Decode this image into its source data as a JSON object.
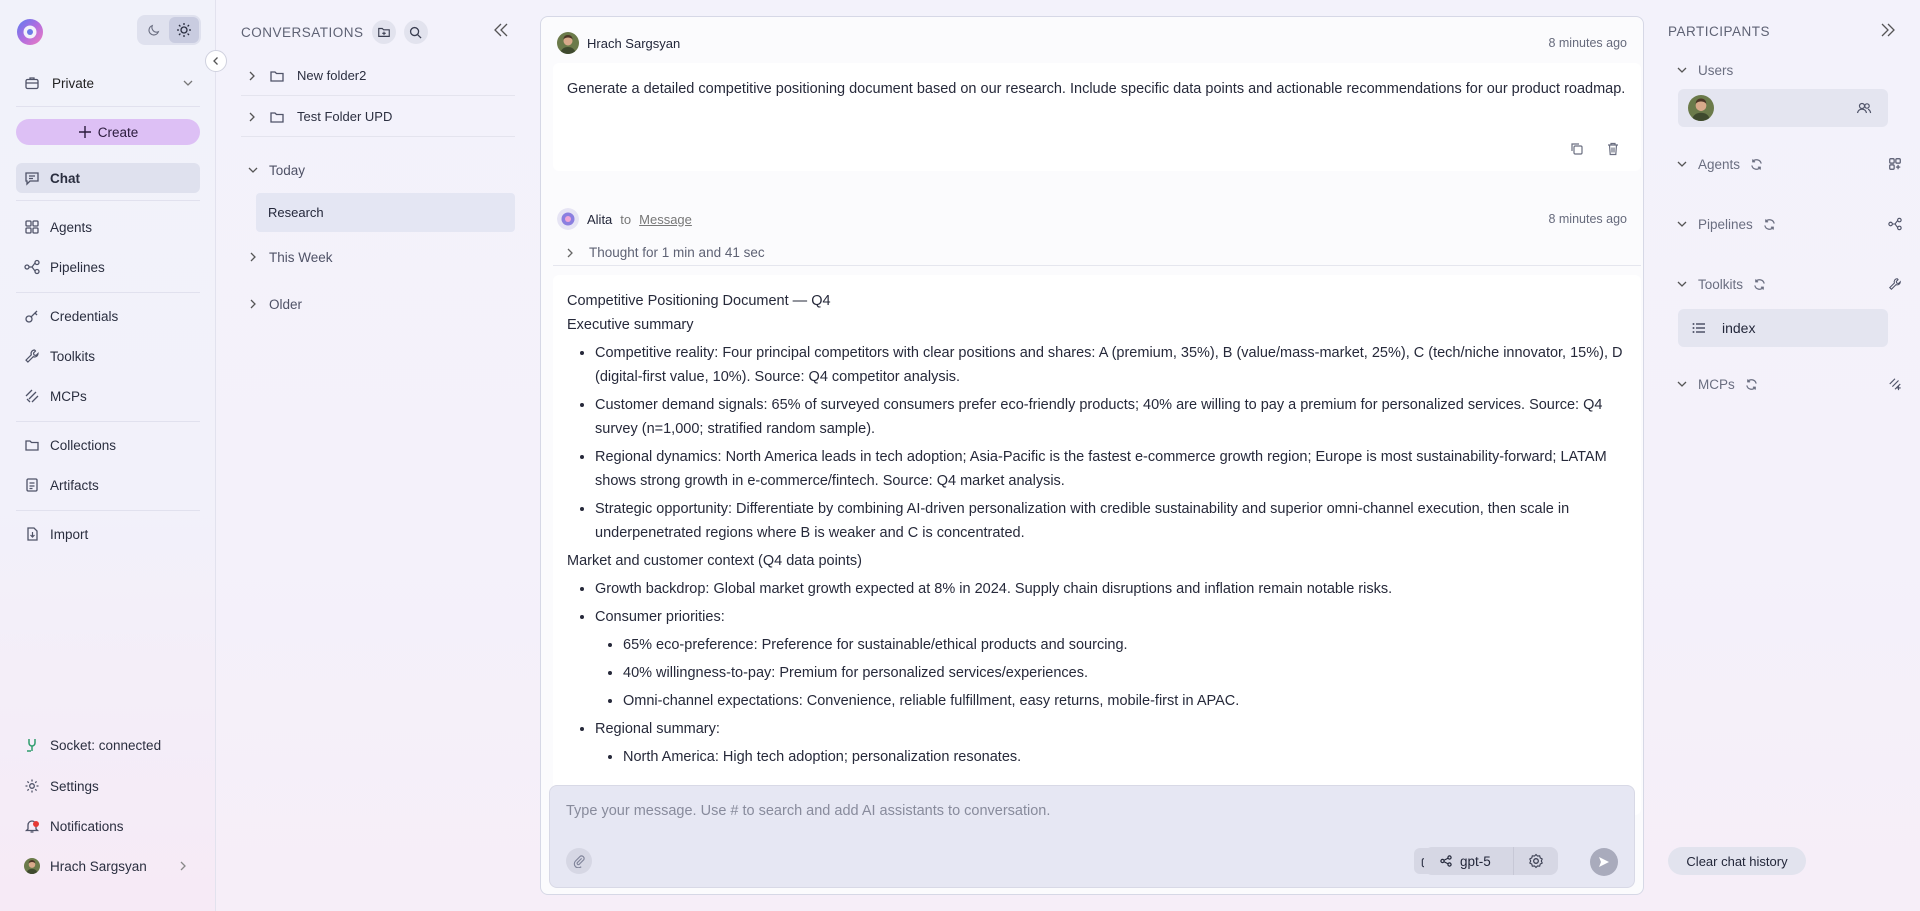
{
  "sidebar": {
    "workspace_label": "Private",
    "create_label": "Create",
    "nav": [
      {
        "label": "Chat"
      },
      {
        "label": "Agents"
      },
      {
        "label": "Pipelines"
      },
      {
        "label": "Credentials"
      },
      {
        "label": "Toolkits"
      },
      {
        "label": "MCPs"
      },
      {
        "label": "Collections"
      },
      {
        "label": "Artifacts"
      },
      {
        "label": "Import"
      }
    ],
    "socket_status": "Socket: connected",
    "settings_label": "Settings",
    "notifications_label": "Notifications",
    "user_name": "Hrach Sargsyan"
  },
  "conversations": {
    "title": "CONVERSATIONS",
    "folders": [
      {
        "label": "New folder2"
      },
      {
        "label": "Test Folder UPD"
      }
    ],
    "groups": {
      "today": "Today",
      "this_week": "This Week",
      "older": "Older"
    },
    "active_item": "Research"
  },
  "chat": {
    "user_message": {
      "author": "Hrach Sargsyan",
      "time": "8 minutes ago",
      "text": "Generate a detailed competitive positioning document based on our research. Include specific data points and actionable recommendations for our product roadmap."
    },
    "assistant_message": {
      "author": "Alita",
      "to_label": "to",
      "target": "Message",
      "time": "8 minutes ago",
      "thought": "Thought for 1 min and 41 sec",
      "title": "Competitive Positioning Document — Q4",
      "exec_heading": "Executive summary",
      "exec_bullets": [
        "Competitive reality: Four principal competitors with clear positions and shares: A (premium, 35%), B (value/mass-market, 25%), C (tech/niche innovator, 15%), D (digital-first value, 10%). Source: Q4 competitor analysis.",
        "Customer demand signals: 65% of surveyed consumers prefer eco-friendly products; 40% are willing to pay a premium for personalized services. Source: Q4 survey (n=1,000; stratified random sample).",
        "Regional dynamics: North America leads in tech adoption; Asia-Pacific is the fastest e-commerce growth region; Europe is most sustainability-forward; LATAM shows strong growth in e-commerce/fintech. Source: Q4 market analysis.",
        "Strategic opportunity: Differentiate by combining AI-driven personalization with credible sustainability and superior omni-channel execution, then scale in underpenetrated regions where B is weaker and C is concentrated."
      ],
      "market_heading": "Market and customer context (Q4 data points)",
      "growth": "Growth backdrop: Global market growth expected at 8% in 2024. Supply chain disruptions and inflation remain notable risks.",
      "consumer_heading": "Consumer priorities:",
      "consumer_bullets": [
        "65% eco-preference: Preference for sustainable/ethical products and sourcing.",
        "40% willingness-to-pay: Premium for personalized services/experiences.",
        "Omni-channel expectations: Convenience, reliable fulfillment, easy returns, mobile-first in APAC."
      ],
      "regional_heading": "Regional summary:",
      "regional_bullets": [
        "North America: High tech adoption; personalization resonates."
      ]
    },
    "input": {
      "placeholder": "Type your message. Use # to search and add AI assistants to conversation."
    },
    "model": "gpt-5"
  },
  "participants": {
    "title": "PARTICIPANTS",
    "sections": {
      "users": "Users",
      "agents": "Agents",
      "pipelines": "Pipelines",
      "toolkits": "Toolkits",
      "mcps": "MCPs"
    },
    "toolkit_item": "index",
    "clear_label": "Clear chat history"
  },
  "colors": {
    "accent": "#ddc0f5",
    "active_bg": "#dfe1ee",
    "socket_green": "#2e9d6e",
    "notification_dot": "#e53935"
  }
}
